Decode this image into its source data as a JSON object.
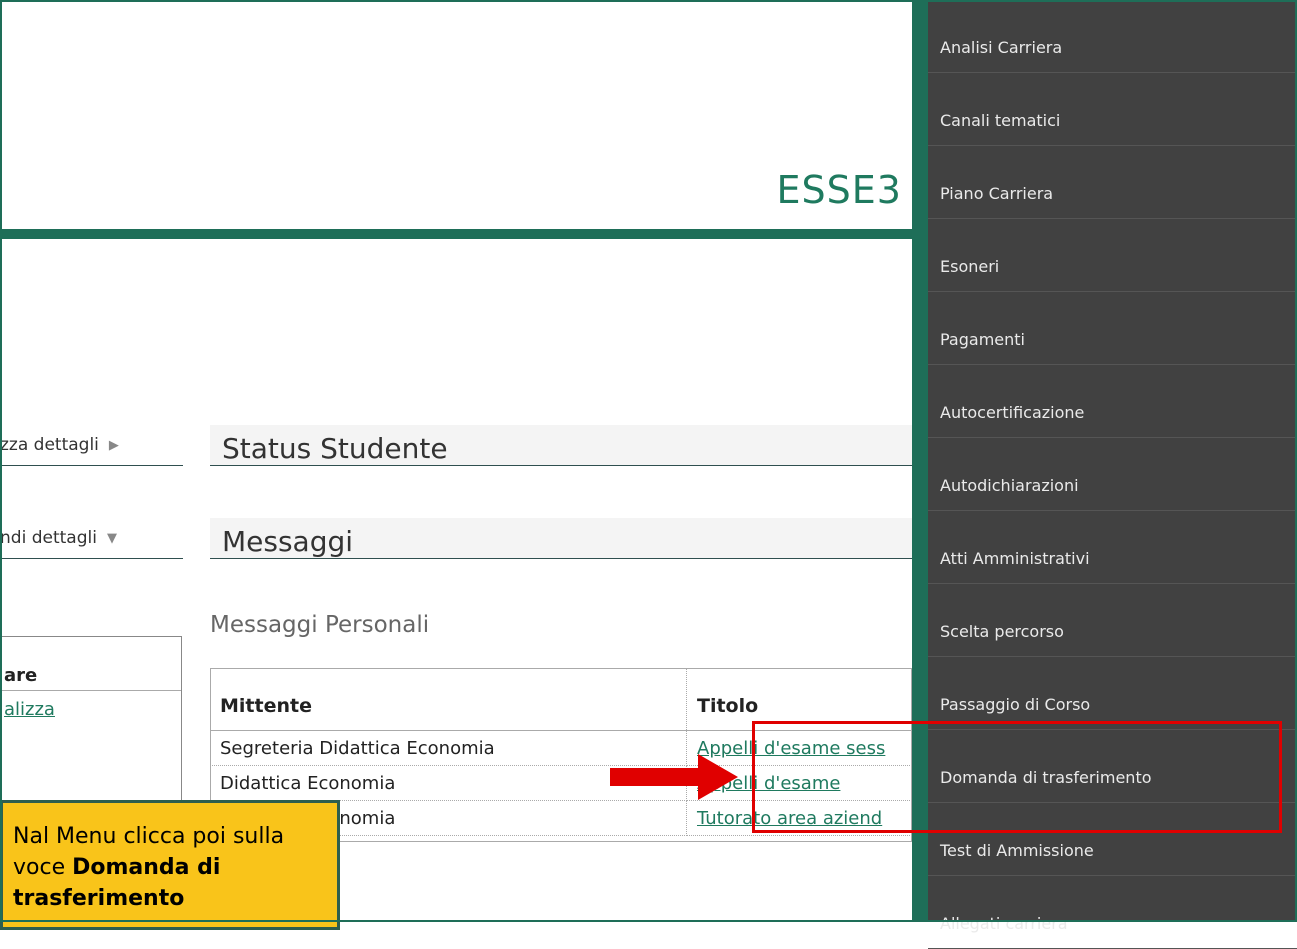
{
  "header": {
    "brand": "ESSE3"
  },
  "left_sections": {
    "status_toggle": "zza dettagli",
    "messages_toggle": "ndi dettagli",
    "left_table_header": "are",
    "left_table_link": "alizza"
  },
  "sections": {
    "status_title": "Status Studente",
    "messages_title": "Messaggi",
    "personal_messages": "Messaggi Personali"
  },
  "messages_table": {
    "headers": {
      "sender": "Mittente",
      "title": "Titolo"
    },
    "rows": [
      {
        "sender": "Segreteria Didattica Economia",
        "title": "Appelli d'esame sess"
      },
      {
        "sender": "Didattica Economia",
        "title": "Appelli d'esame"
      },
      {
        "sender": "Didattica Economia",
        "title": "Tutorato area aziend"
      }
    ]
  },
  "menu": {
    "items": [
      "Analisi Carriera",
      "Canali tematici",
      "Piano Carriera",
      "Esoneri",
      "Pagamenti",
      "Autocertificazione",
      "Autodichiarazioni",
      "Atti Amministrativi",
      "Scelta percorso",
      "Passaggio di Corso",
      "Domanda di trasferimento",
      "Test di Ammissione",
      "Allegati carriera"
    ]
  },
  "callout": {
    "text_start": "Nal Menu clicca poi sulla voce ",
    "text_bold": "Domanda di trasferimento"
  },
  "colors": {
    "accent_green": "#1e6e58",
    "menu_bg": "#414141",
    "highlight_red": "#e00000",
    "callout_yellow": "#f9c41a"
  }
}
